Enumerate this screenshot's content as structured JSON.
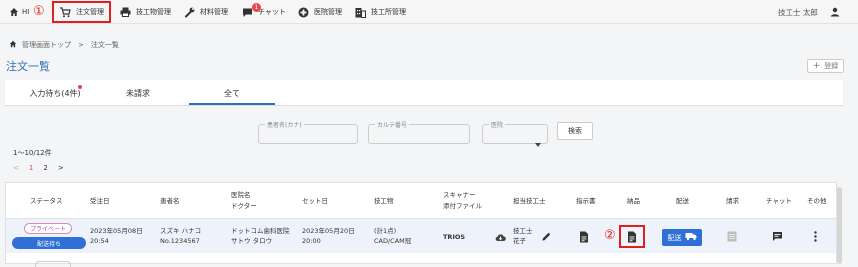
{
  "nav": {
    "items": [
      {
        "label": "HI",
        "icon": "home-icon"
      },
      {
        "label": "注文管理",
        "icon": "cart-icon"
      },
      {
        "label": "技工物管理",
        "icon": "printer-icon"
      },
      {
        "label": "材料管理",
        "icon": "wrench-icon"
      },
      {
        "label": "チャット",
        "icon": "chat-icon",
        "badge": "1"
      },
      {
        "label": "医院管理",
        "icon": "clinic-icon"
      },
      {
        "label": "技工所管理",
        "icon": "building-icon"
      }
    ],
    "user_name": "技工士 太郎",
    "user_icon": "person-icon",
    "annotation_1": "①",
    "annotation_2": "②",
    "annotation_color": "#e02020"
  },
  "breadcrumb": {
    "home": "管理画面トップ",
    "separator": ">",
    "current": "注文一覧"
  },
  "page_title": "注文一覧",
  "register_label": "登録",
  "tabs": [
    {
      "label": "入力待ち(4件)",
      "dot": true
    },
    {
      "label": "未請求"
    },
    {
      "label": "全て",
      "active": true
    }
  ],
  "filters": {
    "patient_kana": "患者名(カナ)",
    "chart_no": "カルテ番号",
    "clinic": "医院",
    "search": "検索"
  },
  "count_text": "1〜10/12件",
  "pagination": {
    "prev": "<",
    "pages": [
      "1",
      "2"
    ],
    "current": "1",
    "next": ">"
  },
  "table": {
    "headers": {
      "status": "ステータス",
      "order_date": "受注日",
      "patient": "患者名",
      "clinic_1": "医院名",
      "clinic_2": "ドクター",
      "set_date": "セット日",
      "product": "技工物",
      "scanner_1": "スキャナー",
      "scanner_2": "添付ファイル",
      "technician": "担当技工士",
      "instructions": "指示書",
      "delivery_note": "納品",
      "shipping": "配送",
      "billing": "請求",
      "chat": "チャット",
      "other": "その他"
    },
    "row": {
      "private_tag": "プライベート",
      "status": "配送待ち",
      "order_date_1": "2023年05月08日",
      "order_date_2": "20:54",
      "patient_1": "スズキ ハナコ",
      "patient_2": "No.1234567",
      "clinic_1": "ドットコム歯科医院",
      "clinic_2": "サトウ タロウ",
      "set_date_1": "2023年05月20日",
      "set_date_2": "20:00",
      "product_1": "(計1点)",
      "product_2": "CAD/CAM冠",
      "scanner": "TRIOS",
      "technician_1": "技工士",
      "technician_2": "花子",
      "ship_label": "配送"
    }
  },
  "colors": {
    "accent": "#2f6fb3",
    "button": "#2f6fd6",
    "private": "#c0508e"
  }
}
